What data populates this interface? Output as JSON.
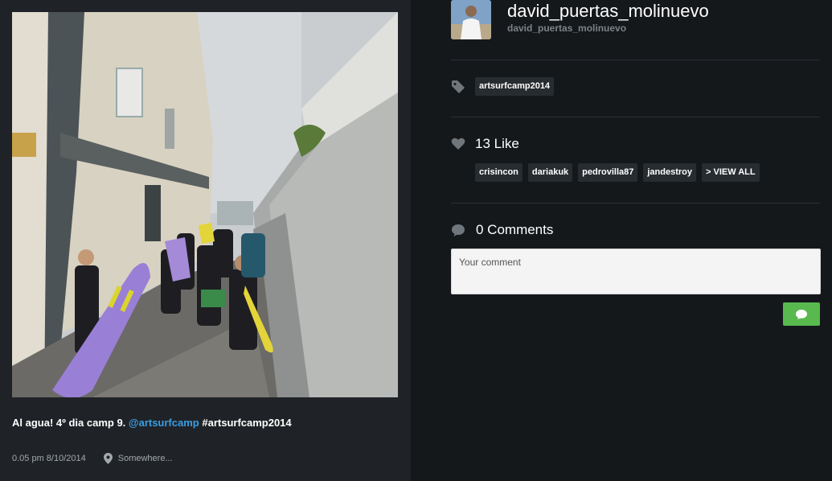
{
  "post": {
    "caption_text": "Al agua! 4º dia camp 9. ",
    "caption_mention": "@artsurfcamp",
    "caption_hashtag": "#artsurfcamp2014",
    "timestamp": "0.05 pm 8/10/2014",
    "location": "Somewhere..."
  },
  "user": {
    "display_name": "david_puertas_molinuevo",
    "handle": "david_puertas_molinuevo"
  },
  "tags": [
    "artsurfcamp2014"
  ],
  "likes": {
    "count_label": "13 Like",
    "users": [
      "crisincon",
      "dariakuk",
      "pedrovilla87",
      "jandestroy"
    ],
    "view_all_label": "> VIEW ALL"
  },
  "comments": {
    "count_label": "0 Comments",
    "placeholder": "Your comment"
  },
  "colors": {
    "accent_send": "#58b94f",
    "link": "#3a9ee4",
    "panel_left": "#1f2327",
    "panel_right": "#15181b"
  },
  "icons": {
    "tag": "tag-icon",
    "like": "heart-icon",
    "comment": "speech-bubble-icon",
    "location": "map-pin-icon",
    "send": "speech-bubble-icon"
  }
}
